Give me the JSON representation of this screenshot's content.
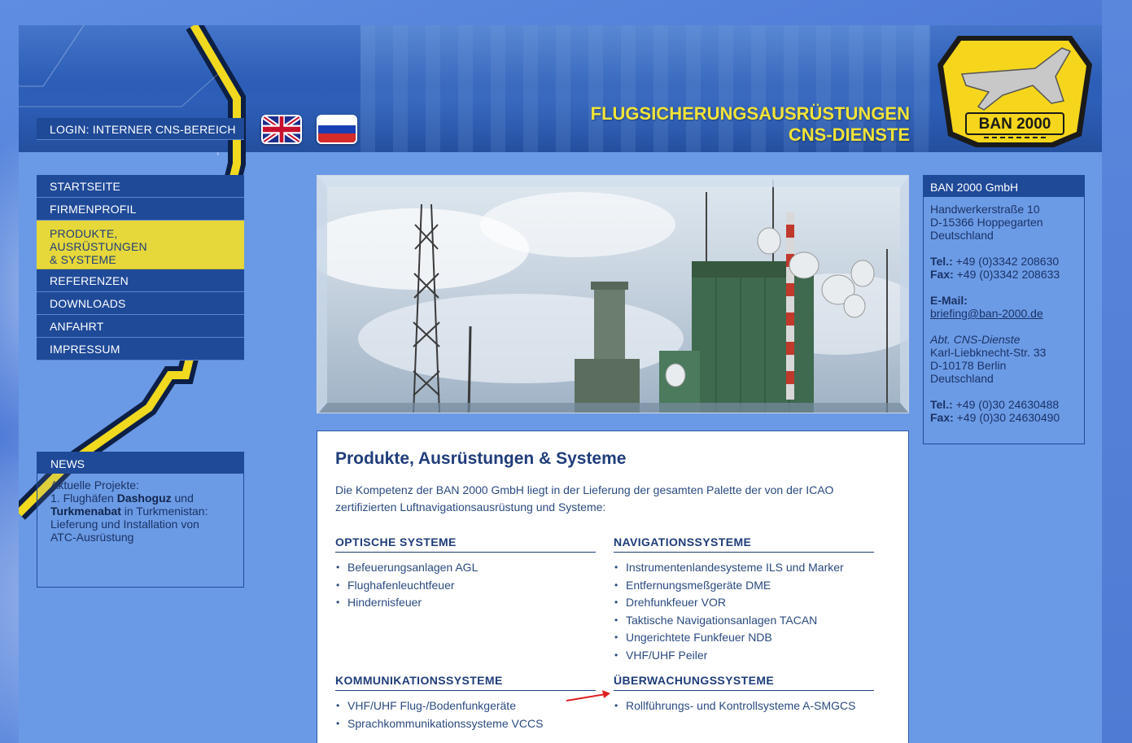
{
  "header": {
    "login_label": "LOGIN: INTERNER CNS-BEREICH",
    "tagline_line1": "FLUGSICHERUNGSAUSRÜSTUNGEN",
    "tagline_line2": "CNS-DIENSTE",
    "logo_text": "BAN 2000"
  },
  "flags": [
    {
      "name": "english-flag-icon"
    },
    {
      "name": "russian-flag-icon"
    }
  ],
  "nav": {
    "items": [
      {
        "label": "STARTSEITE"
      },
      {
        "label": "FIRMENPROFIL"
      },
      {
        "label_lines": [
          "PRODUKTE,",
          "AUSRÜSTUNGEN",
          "& SYSTEME"
        ]
      },
      {
        "label": "REFERENZEN"
      },
      {
        "label": "DOWNLOADS"
      },
      {
        "label": "ANFAHRT"
      },
      {
        "label": "IMPRESSUM"
      }
    ]
  },
  "news": {
    "title": "NEWS",
    "line1": "Aktuelle Projekte:",
    "line2_prefix": "1. Flughäfen ",
    "city1": "Dashoguz",
    "line2_suffix": " und",
    "city2": "Turkmenabat",
    "line3_suffix": " in Turkmenistan:",
    "line4": "Lieferung und Installation von",
    "line5": "ATC-Ausrüstung"
  },
  "content": {
    "title": "Produkte, Ausrüstungen & Systeme",
    "intro": "Die Kompetenz der BAN 2000 GmbH liegt in der Lieferung der gesamten Palette der von der ICAO zertifizierten Luftnavigationsausrüstung und Systeme:",
    "sections": {
      "optische": {
        "title": "OPTISCHE SYSTEME",
        "items": [
          "Befeuerungsanlagen AGL",
          "Flughafenleuchtfeuer",
          "Hindernisfeuer"
        ]
      },
      "navigation": {
        "title": "NAVIGATIONSSYSTEME",
        "items": [
          "Instrumentenlandesysteme ILS und Marker",
          "Entfernungsmeßgeräte DME",
          "Drehfunkfeuer VOR",
          "Taktische Navigationsanlagen TACAN",
          "Ungerichtete Funkfeuer NDB",
          "VHF/UHF Peiler"
        ]
      },
      "kommunikation": {
        "title": "KOMMUNIKATIONSSYSTEME",
        "items": [
          "VHF/UHF Flug-/Bodenfunkgeräte",
          "Sprachkommunikationssysteme VCCS"
        ]
      },
      "ueberwachung": {
        "title": "ÜBERWACHUNGSSYSTEME",
        "items": [
          "Rollführungs- und Kontrollsysteme A-SMGCS"
        ]
      }
    }
  },
  "address": {
    "title": "BAN 2000 GmbH",
    "street": "Handwerkerstraße 10",
    "city": "D-15366 Hoppegarten",
    "country": "Deutschland",
    "tel_label": "Tel.:",
    "tel": " +49 (0)3342 208630",
    "fax_label": "Fax:",
    "fax": " +49 (0)3342 208633",
    "email_label": "E-Mail:",
    "email": "briefing@ban-2000.de",
    "dept": "Abt. CNS-Dienste",
    "street2": "Karl-Liebknecht-Str. 33",
    "city2": "D-10178 Berlin",
    "country2": "Deutschland",
    "tel2": " +49 (0)30 24630488",
    "fax2": " +49 (0)30 24630490"
  },
  "colors": {
    "accent_yellow": "#e6d83a",
    "nav_blue": "#1f4a98",
    "page_blue": "#6a9ae6",
    "annotation_red": "#e02020"
  }
}
